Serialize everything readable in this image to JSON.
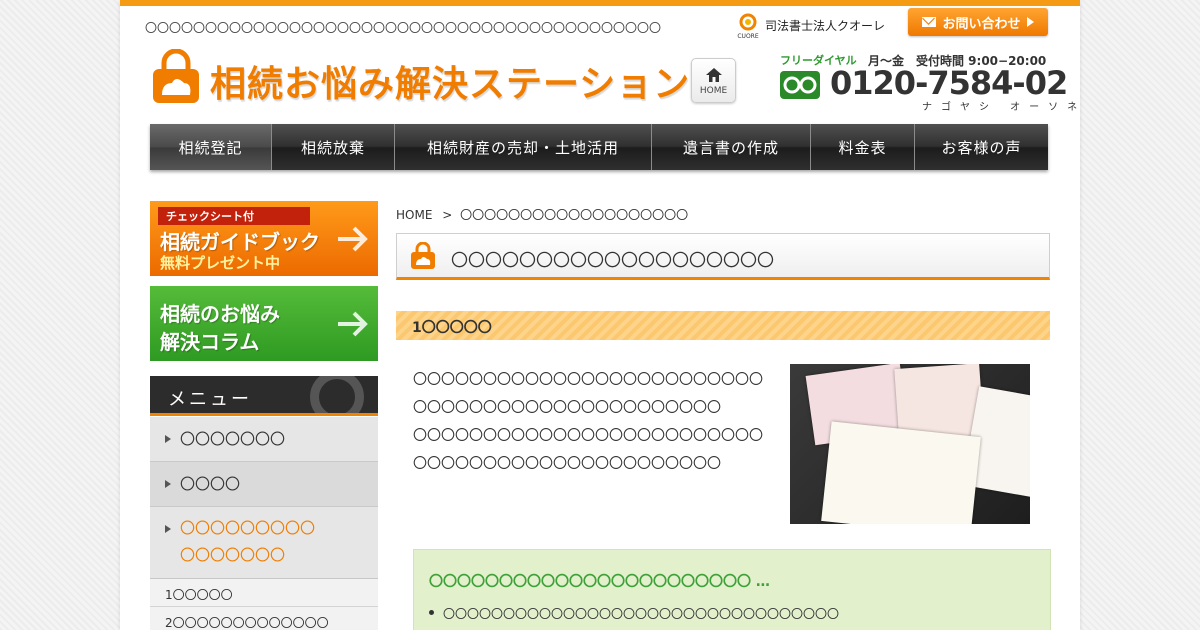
{
  "header": {
    "tagline": "〇〇〇〇〇〇〇〇〇〇〇〇〇〇〇〇〇〇〇〇〇〇〇〇〇〇〇〇〇〇〇〇〇〇〇〇〇〇〇〇〇〇〇",
    "firm_name": "司法書士法人クオーレ",
    "firm_logo_text": "CUORE",
    "contact_label": "お問い合わせ",
    "logo_text": "相続お悩み解決ステーション",
    "home_label": "HOME",
    "phone": {
      "free_dial_label": "フリーダイヤル",
      "hours": "月〜金　受付時間  9:00−20:00",
      "number": "0120-7584-02",
      "reading": "ナゴヤシ オーソネ"
    }
  },
  "nav": {
    "items": [
      {
        "label": "相続登記"
      },
      {
        "label": "相続放棄"
      },
      {
        "label": "相続財産の売却・土地活用"
      },
      {
        "label": "遺言書の作成"
      },
      {
        "label": "料金表"
      },
      {
        "label": "お客様の声"
      }
    ]
  },
  "sidebar": {
    "guide_banner": {
      "strip": "チェックシート付",
      "title": "相続ガイドブック",
      "sub": "無料プレゼント中"
    },
    "column_banner": {
      "line1": "相続のお悩み",
      "line2": "解決コラム"
    },
    "menu_title": "メニュー",
    "menu_items": [
      {
        "label": "〇〇〇〇〇〇〇"
      },
      {
        "label": "〇〇〇〇"
      },
      {
        "label_line1": "〇〇〇〇〇〇〇〇〇",
        "label_line2": "〇〇〇〇〇〇〇"
      }
    ],
    "sub_items": [
      {
        "label": "1〇〇〇〇〇"
      },
      {
        "label": "2〇〇〇〇〇〇〇〇〇〇〇〇〇"
      }
    ]
  },
  "main": {
    "breadcrumb_home": "HOME",
    "breadcrumb_sep": ">",
    "breadcrumb_current": "〇〇〇〇〇〇〇〇〇〇〇〇〇〇〇〇〇〇〇",
    "page_title": "〇〇〇〇〇〇〇〇〇〇〇〇〇〇〇〇〇〇〇",
    "section_heading": "1〇〇〇〇〇",
    "paragraph1": "〇〇〇〇〇〇〇〇〇〇〇〇〇〇〇〇〇〇〇〇〇〇〇〇〇〇〇〇〇〇〇〇〇〇〇〇〇〇〇〇〇〇〇〇〇〇〇",
    "paragraph2": "〇〇〇〇〇〇〇〇〇〇〇〇〇〇〇〇〇〇〇〇〇〇〇〇〇〇〇〇〇〇〇〇〇〇〇〇〇〇〇〇〇〇〇〇〇〇〇",
    "info_heading": "〇〇〇〇〇〇〇〇〇〇〇〇〇〇〇〇〇〇〇〇〇〇〇 …",
    "info_items": [
      {
        "label": "〇〇〇〇〇〇〇〇〇〇〇〇〇〇〇〇〇〇〇〇〇〇〇〇〇〇〇〇〇〇〇〇〇"
      }
    ]
  },
  "colors": {
    "accent": "#f08300",
    "nav_dark": "#2f2f2f",
    "green": "#3fa13a"
  }
}
